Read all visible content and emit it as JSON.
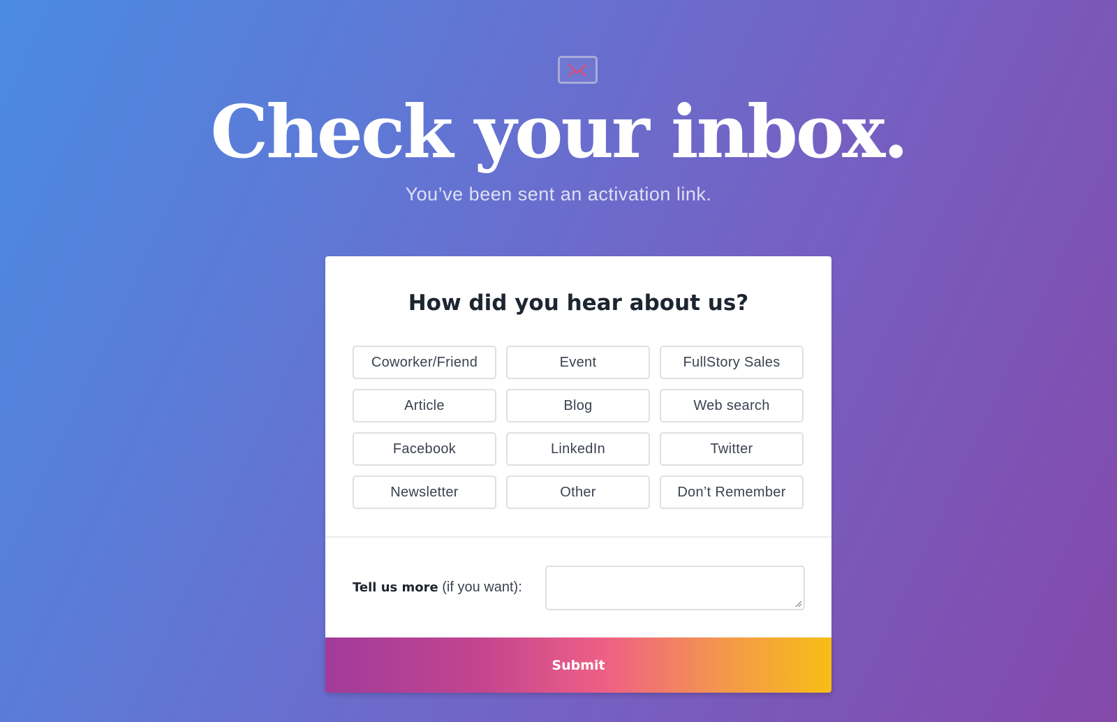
{
  "icons": {
    "envelope": "envelope-icon",
    "resize": "resize-grip-icon"
  },
  "colors": {
    "envelope_mark": "#e8456e",
    "submit_gradient_start": "#a13b9a",
    "submit_gradient_end": "#f6be15"
  },
  "hero": {
    "title": "Check your inbox.",
    "subtitle": "You’ve been sent an activation link."
  },
  "survey": {
    "question": "How did you hear about us?",
    "options": [
      "Coworker/Friend",
      "Event",
      "FullStory Sales",
      "Article",
      "Blog",
      "Web search",
      "Facebook",
      "LinkedIn",
      "Twitter",
      "Newsletter",
      "Other",
      "Don’t Remember"
    ],
    "more_label_bold": "Tell us more",
    "more_label_rest": " (if you want):",
    "more_value": "",
    "submit_label": "Submit"
  }
}
